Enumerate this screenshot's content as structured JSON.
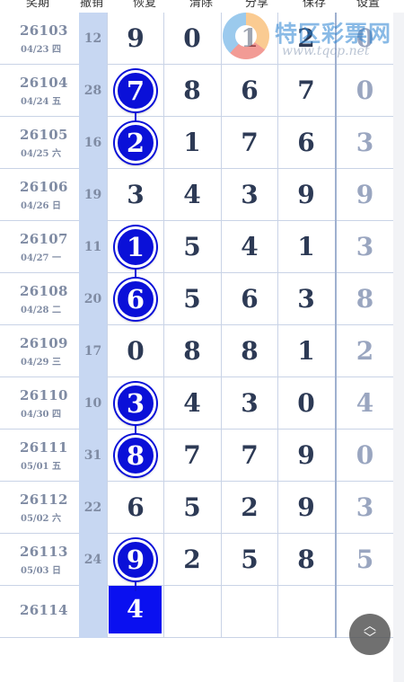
{
  "header": {
    "columns": [
      "奖期",
      "撤销",
      "恢复",
      "清除",
      "分享",
      "保存",
      "设置"
    ]
  },
  "rows": [
    {
      "period": "26103",
      "date": "04/23 四",
      "miss": "12",
      "values": [
        "9",
        "0",
        "1",
        "2",
        "0"
      ],
      "hit_col": null
    },
    {
      "period": "26104",
      "date": "04/24 五",
      "miss": "28",
      "values": [
        "7",
        "8",
        "6",
        "7",
        "0"
      ],
      "hit_col": 0
    },
    {
      "period": "26105",
      "date": "04/25 六",
      "miss": "16",
      "values": [
        "2",
        "1",
        "7",
        "6",
        "3"
      ],
      "hit_col": 0
    },
    {
      "period": "26106",
      "date": "04/26 日",
      "miss": "19",
      "values": [
        "3",
        "4",
        "3",
        "9",
        "9"
      ],
      "hit_col": null
    },
    {
      "period": "26107",
      "date": "04/27 一",
      "miss": "11",
      "values": [
        "1",
        "5",
        "4",
        "1",
        "3"
      ],
      "hit_col": 0
    },
    {
      "period": "26108",
      "date": "04/28 二",
      "miss": "20",
      "values": [
        "6",
        "5",
        "6",
        "3",
        "8"
      ],
      "hit_col": 0
    },
    {
      "period": "26109",
      "date": "04/29 三",
      "miss": "17",
      "values": [
        "0",
        "8",
        "8",
        "1",
        "2"
      ],
      "hit_col": null
    },
    {
      "period": "26110",
      "date": "04/30 四",
      "miss": "10",
      "values": [
        "3",
        "4",
        "3",
        "0",
        "4"
      ],
      "hit_col": 0
    },
    {
      "period": "26111",
      "date": "05/01 五",
      "miss": "31",
      "values": [
        "8",
        "7",
        "7",
        "9",
        "0"
      ],
      "hit_col": 0
    },
    {
      "period": "26112",
      "date": "05/02 六",
      "miss": "22",
      "values": [
        "6",
        "5",
        "2",
        "9",
        "3"
      ],
      "hit_col": null
    },
    {
      "period": "26113",
      "date": "05/03 日",
      "miss": "24",
      "values": [
        "9",
        "2",
        "5",
        "8",
        "5"
      ],
      "hit_col": 0
    },
    {
      "period": "26114",
      "date": "",
      "miss": "",
      "values": [
        "4",
        "",
        "",
        "",
        ""
      ],
      "hit_col": 0,
      "pending": true
    }
  ],
  "watermark": {
    "title": "特区彩票网",
    "url": "www.tqcp.net"
  },
  "scroll_button": {
    "up": "︿",
    "down": "﹀"
  },
  "colors": {
    "ball": "#0a10d8",
    "miss_column": "#c7d7f2",
    "grid": "#c9d3e6",
    "text": "#2d3a55"
  }
}
